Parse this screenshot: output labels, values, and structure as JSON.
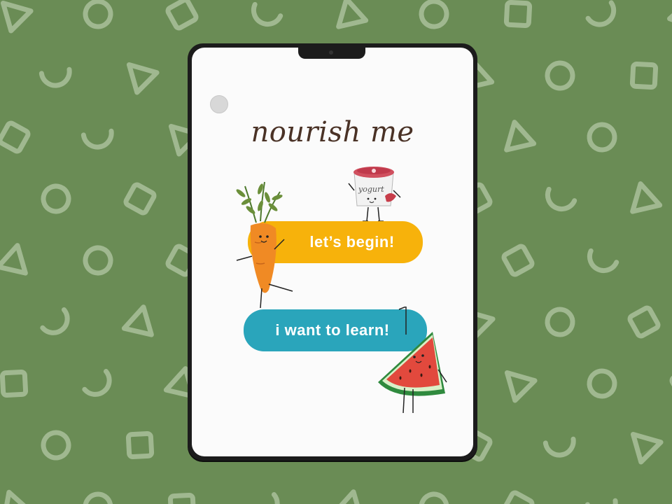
{
  "app": {
    "title": "nourish me"
  },
  "buttons": {
    "begin": "let’s begin!",
    "learn": "i want to learn!"
  },
  "illustrations": {
    "yogurt_label": "yogurt"
  },
  "colors": {
    "background": "#6a8c55",
    "pattern": "#a9bf9b",
    "begin_button": "#f7b20b",
    "learn_button": "#2aa5bb",
    "title": "#4a3226",
    "screen": "#fbfbfb"
  },
  "icons": {
    "menu": "menu-dot-icon",
    "carrot": "carrot-character",
    "yogurt": "yogurt-character",
    "watermelon": "watermelon-character"
  }
}
